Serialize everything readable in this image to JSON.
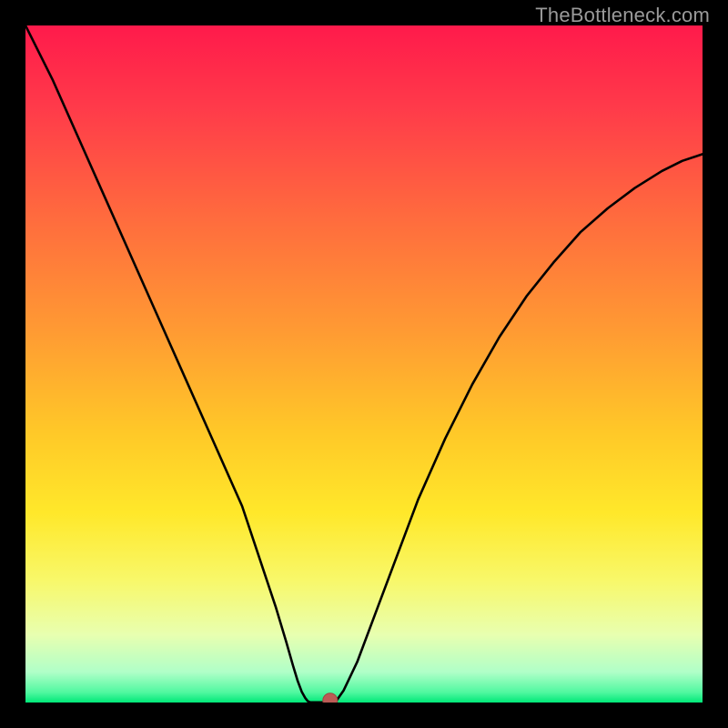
{
  "watermark": "TheBottleneck.com",
  "colors": {
    "frame": "#000000",
    "watermark": "#9a9a9a",
    "curve": "#000000",
    "marker_fill": "#bb5b55",
    "marker_stroke": "#9f4640",
    "gradient_stops": [
      {
        "offset": 0.0,
        "color": "#ff1a4b"
      },
      {
        "offset": 0.12,
        "color": "#ff3a4a"
      },
      {
        "offset": 0.28,
        "color": "#ff6a3e"
      },
      {
        "offset": 0.45,
        "color": "#ff9a33"
      },
      {
        "offset": 0.6,
        "color": "#ffc828"
      },
      {
        "offset": 0.72,
        "color": "#ffe82a"
      },
      {
        "offset": 0.82,
        "color": "#f8f86a"
      },
      {
        "offset": 0.9,
        "color": "#e8ffb0"
      },
      {
        "offset": 0.955,
        "color": "#b0ffc8"
      },
      {
        "offset": 0.985,
        "color": "#50f8a0"
      },
      {
        "offset": 1.0,
        "color": "#00e878"
      }
    ]
  },
  "chart_data": {
    "type": "line",
    "title": "",
    "xlabel": "",
    "ylabel": "",
    "xlim": [
      0,
      100
    ],
    "ylim": [
      0,
      100
    ],
    "grid": false,
    "legend": false,
    "series": [
      {
        "name": "left-branch",
        "x": [
          0,
          4,
          8,
          12,
          16,
          20,
          24,
          28,
          32,
          35,
          37,
          38.5,
          39.5,
          40.2,
          40.8,
          41.3,
          41.7,
          42.0
        ],
        "y": [
          100,
          92,
          83,
          74,
          65,
          56,
          47,
          38,
          29,
          20,
          14,
          9,
          5.5,
          3.2,
          1.6,
          0.7,
          0.2,
          0.05
        ]
      },
      {
        "name": "valley-floor",
        "x": [
          42.0,
          42.5,
          43.0,
          43.5,
          44.0,
          44.5,
          45.0,
          45.8
        ],
        "y": [
          0.05,
          0.03,
          0.02,
          0.02,
          0.02,
          0.03,
          0.05,
          0.08
        ]
      },
      {
        "name": "right-branch",
        "x": [
          45.8,
          47,
          49,
          52,
          55,
          58,
          62,
          66,
          70,
          74,
          78,
          82,
          86,
          90,
          94,
          97,
          100
        ],
        "y": [
          0.08,
          1.8,
          6,
          14,
          22,
          30,
          39,
          47,
          54,
          60,
          65,
          69.5,
          73,
          76,
          78.5,
          80,
          81
        ]
      }
    ],
    "annotations": [
      {
        "name": "min-marker",
        "x": 45,
        "y": 0.3
      }
    ]
  }
}
